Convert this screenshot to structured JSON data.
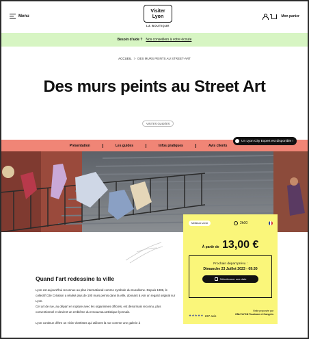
{
  "header": {
    "menu_label": "Menu",
    "logo_line1": "Visiter",
    "logo_line2": "Lyon",
    "logo_sub": "LA BOUTIQUE",
    "user_icon": "user-icon",
    "cart_icon": "cart-icon",
    "cart_label": "Mon panier"
  },
  "helpbar": {
    "question": "Besoin d'aide ?",
    "link": "Nos conseillers à votre écoute"
  },
  "breadcrumb": {
    "home": "ACCUEIL",
    "separator": ">",
    "current": "DES MURS PEINTS AU STREET-ART"
  },
  "page": {
    "title": "Des murs peints au Street Art",
    "tag": "VISITES GUIDÉES"
  },
  "nav": {
    "items": [
      "Présentation",
      "Les guides",
      "Infos pratiques",
      "Avis clients"
    ]
  },
  "expert": {
    "label": "Un Lyon City Expert est disponible !"
  },
  "card": {
    "rating_badge": "Meilleure vente",
    "duration": "2h00",
    "price_prefix": "À partir de",
    "price": "13,00 €",
    "next_label": "Prochain départ prévu :",
    "next_date": "Dimanche 23 Juillet 2023 - 09:30",
    "button": "Sélectionner une date",
    "stars": "★★★★★",
    "reviews": "237 avis",
    "by_label": "Visite proposée par",
    "by_name": "ONLYLYON Tourisme et Congrès",
    "colors": {
      "background": "#faf67a",
      "stars": "#3b4a9a"
    }
  },
  "content": {
    "heading": "Quand l'art redessine la ville",
    "p1": "Lyon est aujourd'hui reconnue au plan international comme symbole du muralisme. Depuis 1986, le collectif Cité Création a réalisé plus de 100 murs peints dans la ville, donnant à voir un regard original sur Lyon.",
    "p2": "Cet art de rue, au départ en rupture avec les organismes officiels, est désormais reconnu, plus conventionnel et devient un emblème du renouveau artistique lyonnais.",
    "p3": "Lyon continue d'être un vivier d'artistes qui utilisent la rue comme une galerie à"
  },
  "colors": {
    "helpbar": "#d7f5c3",
    "nav": "#f08576",
    "dark": "#111111"
  }
}
